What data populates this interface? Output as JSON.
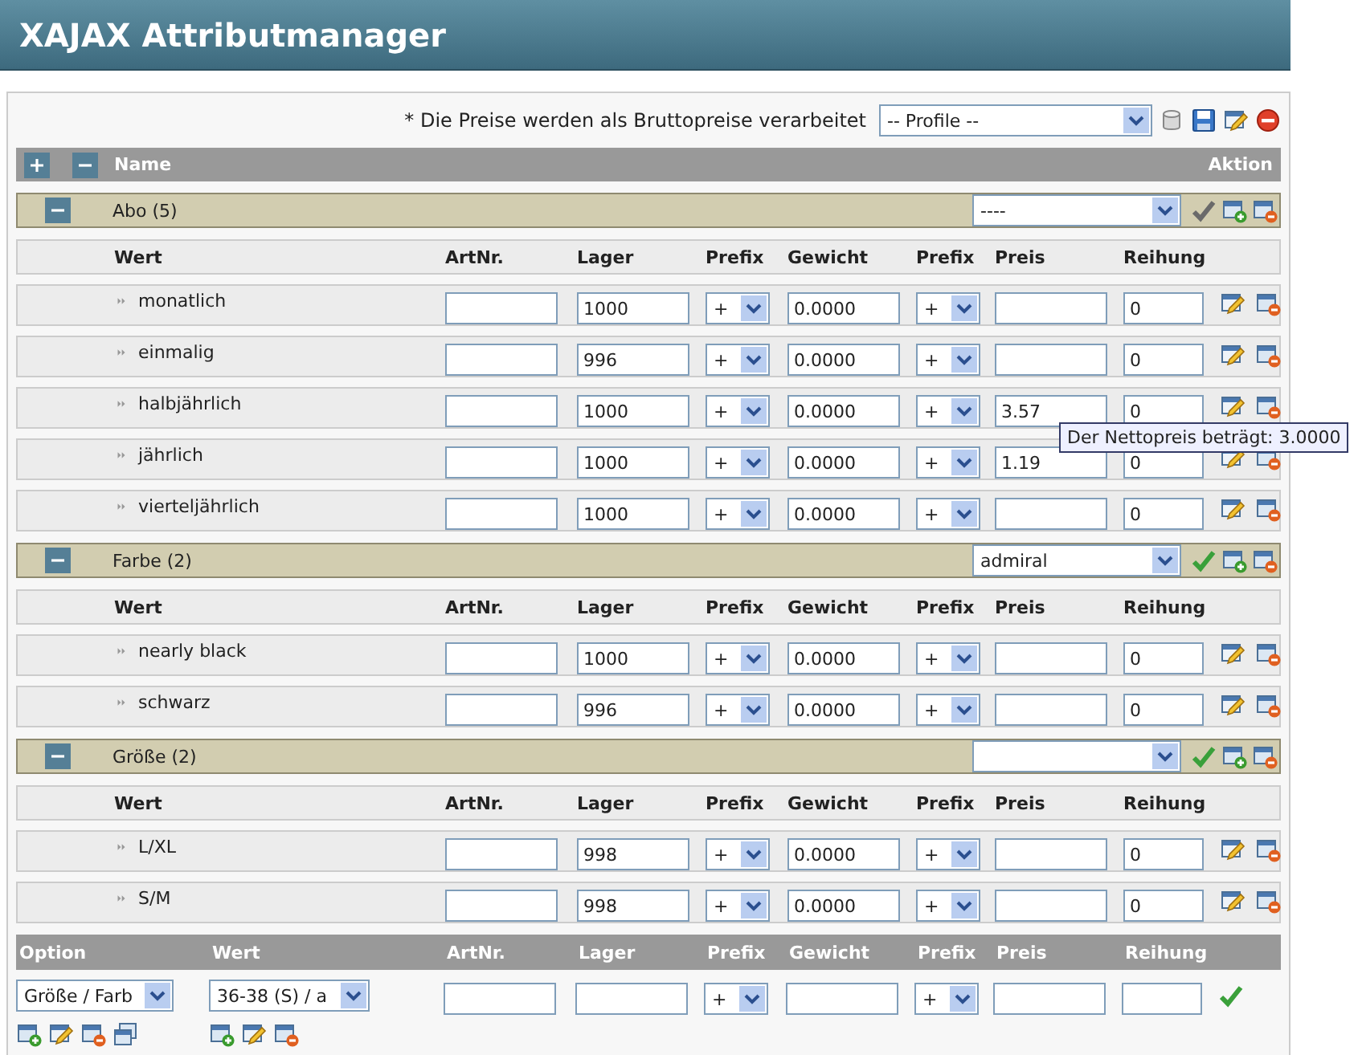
{
  "title": "XAJAX Attributmanager",
  "note": "* Die Preise werden als Bruttopreise verarbeitet",
  "profile_select": "-- Profile --",
  "header": {
    "name_label": "Name",
    "action_label": "Aktion"
  },
  "groups": [
    {
      "name": "Abo (5)",
      "expanded": true,
      "select": "----",
      "check_active": false,
      "columns": [
        "Wert",
        "ArtNr.",
        "Lager",
        "Prefix",
        "Gewicht",
        "Prefix",
        "Preis",
        "Reihung"
      ],
      "rows": [
        {
          "value": "monatlich",
          "lager": "1000",
          "prefix1": "+",
          "gewicht": "0.0000",
          "prefix2": "+",
          "reihung": "0"
        },
        {
          "value": "einmalig",
          "lager": "996",
          "prefix1": "+",
          "gewicht": "0.0000",
          "prefix2": "+",
          "reihung": "0"
        },
        {
          "value": "halbjährlich",
          "lager": "1000",
          "prefix1": "+",
          "gewicht": "0.0000",
          "prefix2": "+",
          "preis": "3.57",
          "reihung": "0",
          "tooltip": "Der Nettopreis beträgt: 3.0000"
        },
        {
          "value": "jährlich",
          "lager": "1000",
          "prefix1": "+",
          "gewicht": "0.0000",
          "prefix2": "+",
          "preis": "1.19",
          "reihung": "0"
        },
        {
          "value": "vierteljährlich",
          "lager": "1000",
          "prefix1": "+",
          "gewicht": "0.0000",
          "prefix2": "+",
          "reihung": "0"
        }
      ]
    },
    {
      "name": "Farbe (2)",
      "expanded": true,
      "select": "admiral",
      "check_active": true,
      "columns": [
        "Wert",
        "ArtNr.",
        "Lager",
        "Prefix",
        "Gewicht",
        "Prefix",
        "Preis",
        "Reihung"
      ],
      "rows": [
        {
          "value": "nearly black",
          "lager": "1000",
          "prefix1": "+",
          "gewicht": "0.0000",
          "prefix2": "+",
          "reihung": "0"
        },
        {
          "value": "schwarz",
          "lager": "996",
          "prefix1": "+",
          "gewicht": "0.0000",
          "prefix2": "+",
          "reihung": "0"
        }
      ]
    },
    {
      "name": "Größe (2)",
      "expanded": true,
      "check_active": true,
      "columns": [
        "Wert",
        "ArtNr.",
        "Lager",
        "Prefix",
        "Gewicht",
        "Prefix",
        "Preis",
        "Reihung"
      ],
      "rows": [
        {
          "value": "L/XL",
          "lager": "998",
          "prefix1": "+",
          "gewicht": "0.0000",
          "prefix2": "+",
          "reihung": "0"
        },
        {
          "value": "S/M",
          "lager": "998",
          "prefix1": "+",
          "gewicht": "0.0000",
          "prefix2": "+",
          "reihung": "0"
        }
      ]
    }
  ],
  "new_entry": {
    "columns": [
      "Option",
      "Wert",
      "ArtNr.",
      "Lager",
      "Prefix",
      "Gewicht",
      "Prefix",
      "Preis",
      "Reihung"
    ],
    "option_select": "Größe / Farb",
    "value_select": "36-38 (S) / a",
    "prefix1": "+",
    "prefix2": "+"
  }
}
